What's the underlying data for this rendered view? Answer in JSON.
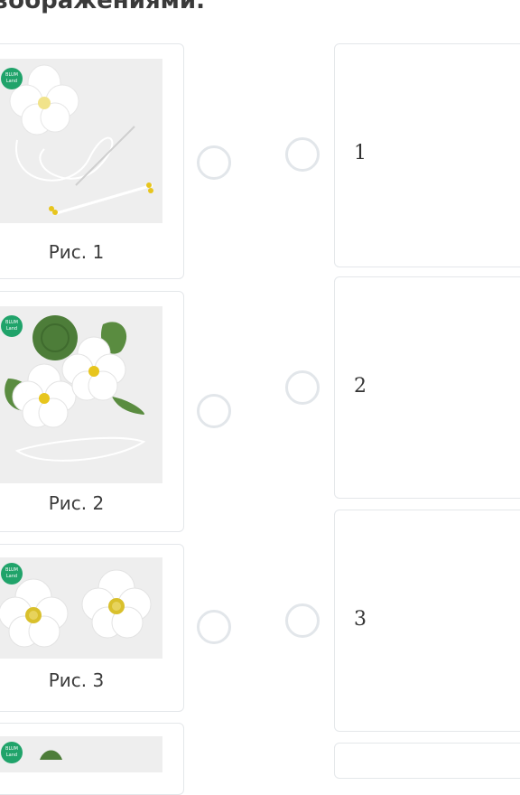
{
  "question": {
    "heading": "зображениями."
  },
  "images": [
    {
      "caption": "Рис. 1",
      "alt": "Рис. 1"
    },
    {
      "caption": "Рис. 2",
      "alt": "Рис. 2"
    },
    {
      "caption": "Рис. 3",
      "alt": "Рис. 3"
    },
    {
      "caption": "",
      "alt": ""
    }
  ],
  "logo": {
    "line1": "BLUM",
    "line2": "Land"
  },
  "answers": [
    {
      "label": "1"
    },
    {
      "label": "2"
    },
    {
      "label": "3"
    }
  ],
  "colors": {
    "border": "#e4e7ea",
    "radio_border": "#e2e6ea",
    "logo_green": "#20a36a",
    "leaf_green": "#4d7d39",
    "flower_white": "#ffffff",
    "stamen_yellow": "#e7c51d"
  }
}
